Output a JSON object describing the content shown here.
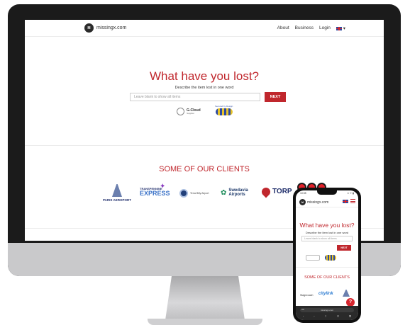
{
  "desktop": {
    "logo": {
      "mark": "M",
      "text": "missingx.com"
    },
    "nav": {
      "about": "About",
      "business": "Business",
      "login": "Login",
      "language_caret": "▾"
    },
    "hero": {
      "title": "What have you lost?",
      "subtitle": "Describe the item lost in one word",
      "search_placeholder": "Leave blank to show all items",
      "next_label": "NEXT"
    },
    "badges": {
      "gcloud_text": "G-Cloud",
      "gcloud_supplier": "Supplier",
      "award_caption": "Secured by Design"
    },
    "clients": {
      "title": "SOME OF OUR CLIENTS",
      "logos": [
        {
          "name": "PARIS AEROPORT"
        },
        {
          "name_top": "TRANSPENNINE",
          "name_bottom": "EXPRESS"
        },
        {
          "name": "Terra Billy Airport"
        },
        {
          "name_top": "Swedavia",
          "name_bottom": "Airports"
        },
        {
          "name": "TORP"
        }
      ]
    }
  },
  "phone": {
    "status_time": "10:55",
    "status_right": "▪▪ ᯤ ▮",
    "logo_text": "missingx.com",
    "title": "What have you lost?",
    "subtitle": "Describe the item lost in one word",
    "search_placeholder": "Leave blank to show all items",
    "next_label": "NEXT",
    "clients_title": "SOME OF OUR CLIENTS",
    "client1": "Stagecoach",
    "client2": "citylink",
    "help_label": "?",
    "url": "missingx.com",
    "aa_label": "AA",
    "toolbar": [
      "‹",
      "›",
      "⇪",
      "⊡",
      "⧉"
    ]
  },
  "colors": {
    "brand_red": "#c0272d",
    "monitor_bezel": "#1b1b1b",
    "chin": "#c9c9cb"
  },
  "icons": [
    "logo-icon",
    "uk-flag-icon",
    "chevron-down-icon",
    "hamburger-icon",
    "help-icon"
  ]
}
